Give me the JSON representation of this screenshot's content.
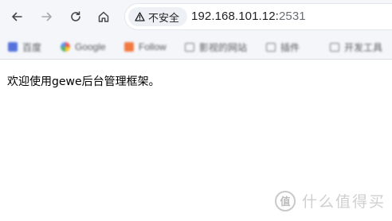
{
  "address_bar": {
    "security_label": "不安全",
    "url_host": "192.168.101.12:",
    "url_port": "2531"
  },
  "bookmarks": [
    {
      "label": "百度",
      "icon": "baidu-icon"
    },
    {
      "label": "Google",
      "icon": "google-icon"
    },
    {
      "label": "Follow",
      "icon": "follow-icon"
    },
    {
      "label": "影视的网站",
      "icon": "folder-icon"
    },
    {
      "label": "插件",
      "icon": "folder-icon"
    },
    {
      "label": "开发工具",
      "icon": "folder-icon"
    }
  ],
  "page": {
    "welcome_text": "欢迎使用gewe后台管理框架。"
  },
  "watermark": {
    "logo_glyph": "值",
    "text": "什么值得买"
  }
}
